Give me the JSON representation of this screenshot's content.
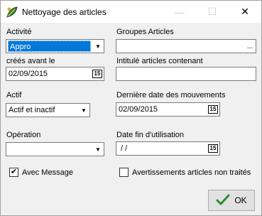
{
  "window": {
    "title": "Nettoyage des articles",
    "controls": {
      "minimize": "—",
      "maximize": "☐",
      "close": "✕"
    }
  },
  "form": {
    "activite": {
      "label": "Activité",
      "value": "Appro"
    },
    "groupes_articles": {
      "label": "Groupes Articles",
      "value": "",
      "button": "..."
    },
    "crees_avant": {
      "label": "créés avant le",
      "value": "02/09/2015"
    },
    "intitule": {
      "label": "Intitulé articles contenant",
      "value": ""
    },
    "actif": {
      "label": "Actif",
      "value": "Actif et inactif"
    },
    "derniere_date": {
      "label": "Dernière date des mouvements",
      "value": "02/09/2015"
    },
    "operation": {
      "label": "Opération",
      "value": ""
    },
    "date_fin": {
      "label": "Date fin d'utilisation",
      "value": " / /"
    },
    "avec_message": {
      "label": "Avec Message",
      "checked": true
    },
    "avertissements": {
      "label": "Avertissements articles non traités",
      "checked": false
    },
    "calendar_glyph": "15"
  },
  "buttons": {
    "ok": "OK"
  },
  "icons": {
    "app": "leaf-app-icon",
    "combo": "chevron-down-icon",
    "calendar": "calendar-icon",
    "ok": "checkmark-icon"
  },
  "colors": {
    "selection": "#0078d7",
    "ok_check": "#2e8b2e"
  }
}
